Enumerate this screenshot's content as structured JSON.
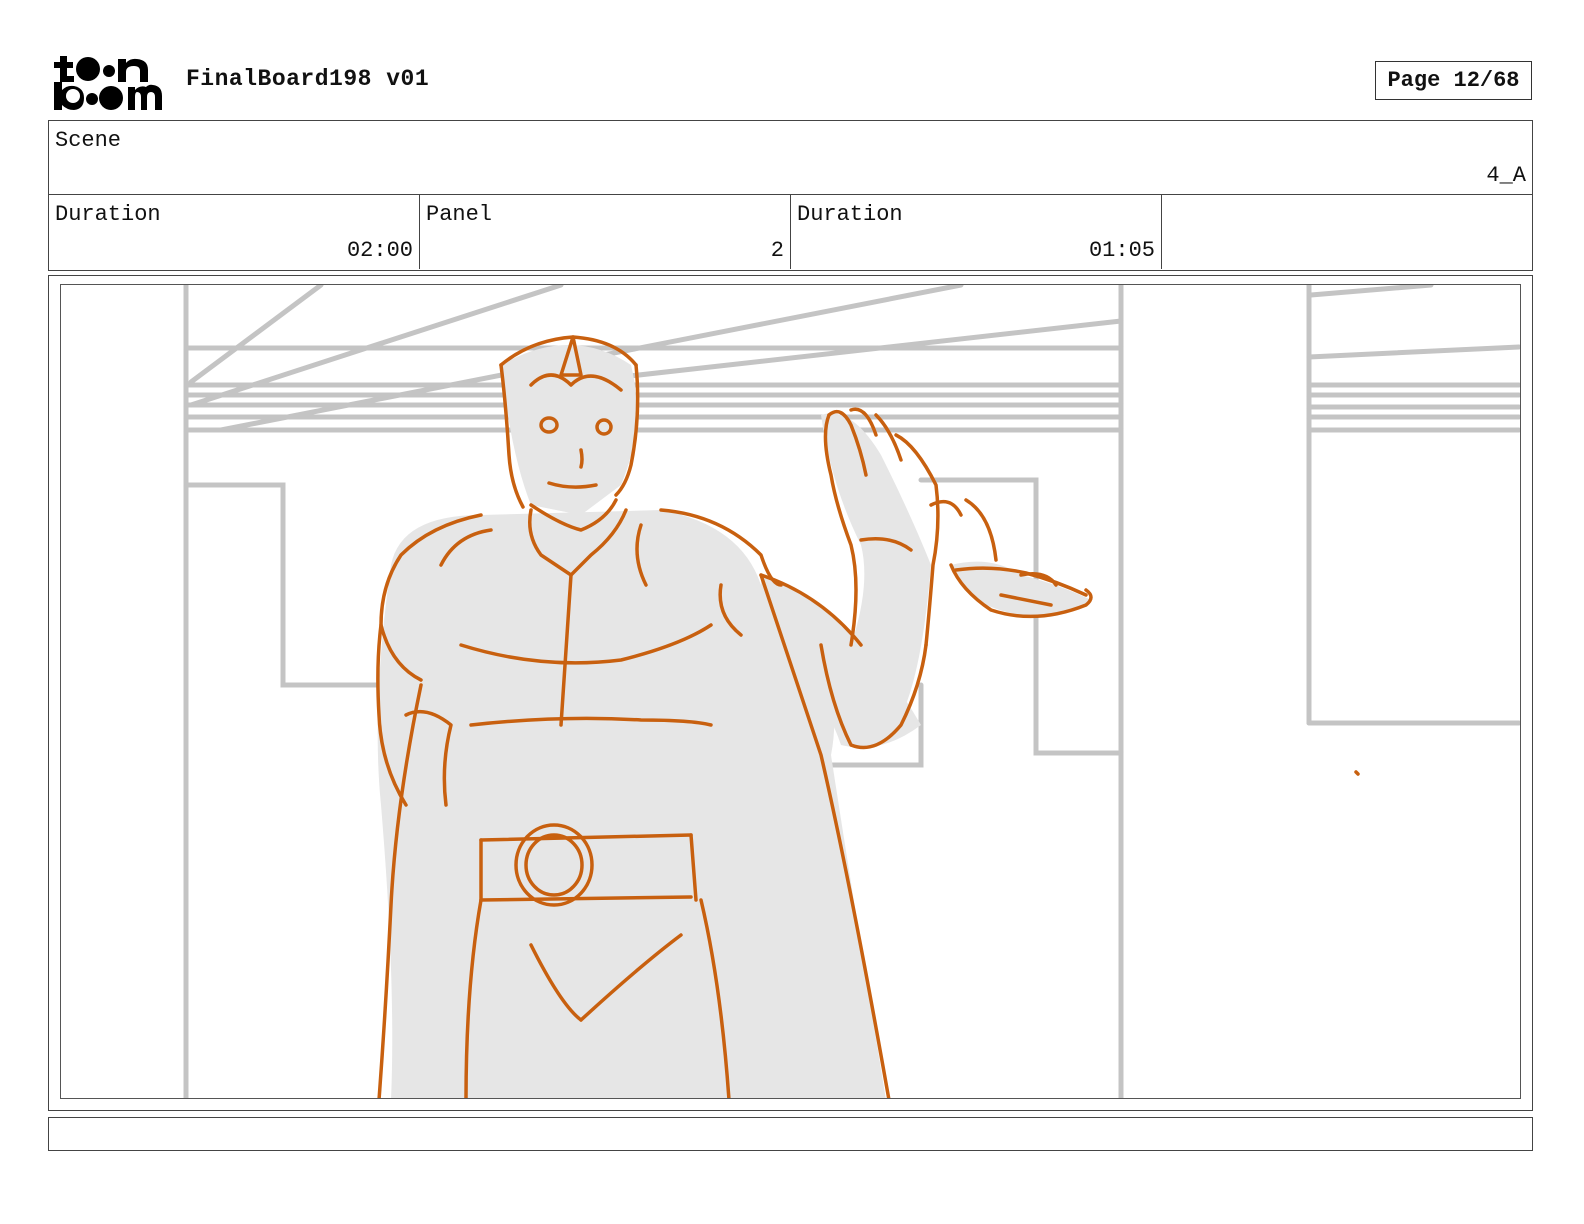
{
  "header": {
    "logo_text": "toon boom",
    "board_title": "FinalBoard198 v01",
    "page_label": "Page 12/68"
  },
  "scene": {
    "label": "Scene",
    "value": "4_A"
  },
  "meta": [
    {
      "label": "Duration",
      "value": "02:00"
    },
    {
      "label": "Panel",
      "value": "2"
    },
    {
      "label": "Duration",
      "value": "01:05"
    },
    {
      "label": "",
      "value": ""
    }
  ],
  "panel": {
    "sketch_line_color": "#c8600f",
    "background_line_color": "#c4c4c4",
    "fill_color": "#e6e6e6"
  },
  "caption": {
    "text": ""
  }
}
